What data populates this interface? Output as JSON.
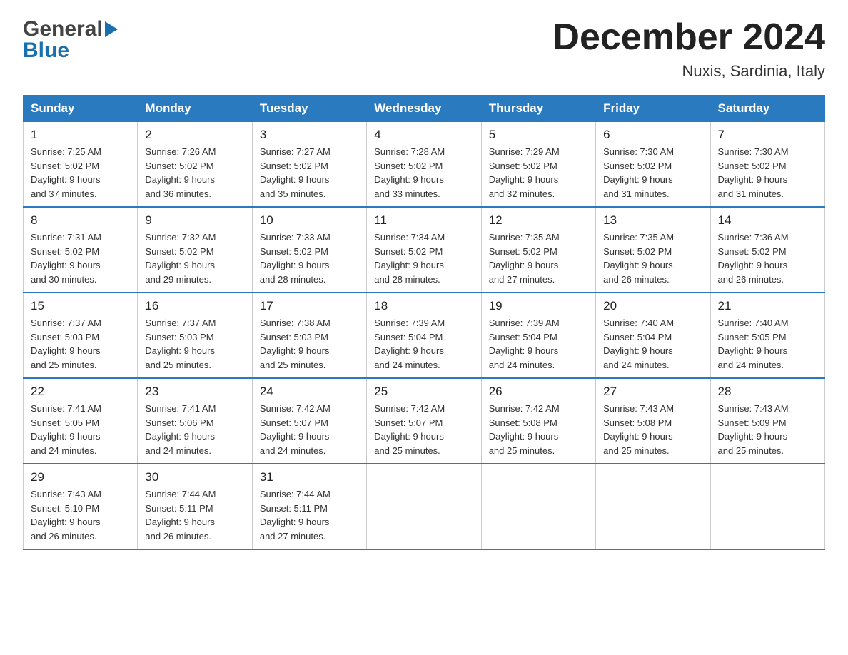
{
  "logo": {
    "line1": "General",
    "line2": "Blue"
  },
  "title": "December 2024",
  "subtitle": "Nuxis, Sardinia, Italy",
  "days_of_week": [
    "Sunday",
    "Monday",
    "Tuesday",
    "Wednesday",
    "Thursday",
    "Friday",
    "Saturday"
  ],
  "weeks": [
    [
      {
        "day": "1",
        "sunrise": "Sunrise: 7:25 AM",
        "sunset": "Sunset: 5:02 PM",
        "daylight": "Daylight: 9 hours",
        "daylight2": "and 37 minutes."
      },
      {
        "day": "2",
        "sunrise": "Sunrise: 7:26 AM",
        "sunset": "Sunset: 5:02 PM",
        "daylight": "Daylight: 9 hours",
        "daylight2": "and 36 minutes."
      },
      {
        "day": "3",
        "sunrise": "Sunrise: 7:27 AM",
        "sunset": "Sunset: 5:02 PM",
        "daylight": "Daylight: 9 hours",
        "daylight2": "and 35 minutes."
      },
      {
        "day": "4",
        "sunrise": "Sunrise: 7:28 AM",
        "sunset": "Sunset: 5:02 PM",
        "daylight": "Daylight: 9 hours",
        "daylight2": "and 33 minutes."
      },
      {
        "day": "5",
        "sunrise": "Sunrise: 7:29 AM",
        "sunset": "Sunset: 5:02 PM",
        "daylight": "Daylight: 9 hours",
        "daylight2": "and 32 minutes."
      },
      {
        "day": "6",
        "sunrise": "Sunrise: 7:30 AM",
        "sunset": "Sunset: 5:02 PM",
        "daylight": "Daylight: 9 hours",
        "daylight2": "and 31 minutes."
      },
      {
        "day": "7",
        "sunrise": "Sunrise: 7:30 AM",
        "sunset": "Sunset: 5:02 PM",
        "daylight": "Daylight: 9 hours",
        "daylight2": "and 31 minutes."
      }
    ],
    [
      {
        "day": "8",
        "sunrise": "Sunrise: 7:31 AM",
        "sunset": "Sunset: 5:02 PM",
        "daylight": "Daylight: 9 hours",
        "daylight2": "and 30 minutes."
      },
      {
        "day": "9",
        "sunrise": "Sunrise: 7:32 AM",
        "sunset": "Sunset: 5:02 PM",
        "daylight": "Daylight: 9 hours",
        "daylight2": "and 29 minutes."
      },
      {
        "day": "10",
        "sunrise": "Sunrise: 7:33 AM",
        "sunset": "Sunset: 5:02 PM",
        "daylight": "Daylight: 9 hours",
        "daylight2": "and 28 minutes."
      },
      {
        "day": "11",
        "sunrise": "Sunrise: 7:34 AM",
        "sunset": "Sunset: 5:02 PM",
        "daylight": "Daylight: 9 hours",
        "daylight2": "and 28 minutes."
      },
      {
        "day": "12",
        "sunrise": "Sunrise: 7:35 AM",
        "sunset": "Sunset: 5:02 PM",
        "daylight": "Daylight: 9 hours",
        "daylight2": "and 27 minutes."
      },
      {
        "day": "13",
        "sunrise": "Sunrise: 7:35 AM",
        "sunset": "Sunset: 5:02 PM",
        "daylight": "Daylight: 9 hours",
        "daylight2": "and 26 minutes."
      },
      {
        "day": "14",
        "sunrise": "Sunrise: 7:36 AM",
        "sunset": "Sunset: 5:02 PM",
        "daylight": "Daylight: 9 hours",
        "daylight2": "and 26 minutes."
      }
    ],
    [
      {
        "day": "15",
        "sunrise": "Sunrise: 7:37 AM",
        "sunset": "Sunset: 5:03 PM",
        "daylight": "Daylight: 9 hours",
        "daylight2": "and 25 minutes."
      },
      {
        "day": "16",
        "sunrise": "Sunrise: 7:37 AM",
        "sunset": "Sunset: 5:03 PM",
        "daylight": "Daylight: 9 hours",
        "daylight2": "and 25 minutes."
      },
      {
        "day": "17",
        "sunrise": "Sunrise: 7:38 AM",
        "sunset": "Sunset: 5:03 PM",
        "daylight": "Daylight: 9 hours",
        "daylight2": "and 25 minutes."
      },
      {
        "day": "18",
        "sunrise": "Sunrise: 7:39 AM",
        "sunset": "Sunset: 5:04 PM",
        "daylight": "Daylight: 9 hours",
        "daylight2": "and 24 minutes."
      },
      {
        "day": "19",
        "sunrise": "Sunrise: 7:39 AM",
        "sunset": "Sunset: 5:04 PM",
        "daylight": "Daylight: 9 hours",
        "daylight2": "and 24 minutes."
      },
      {
        "day": "20",
        "sunrise": "Sunrise: 7:40 AM",
        "sunset": "Sunset: 5:04 PM",
        "daylight": "Daylight: 9 hours",
        "daylight2": "and 24 minutes."
      },
      {
        "day": "21",
        "sunrise": "Sunrise: 7:40 AM",
        "sunset": "Sunset: 5:05 PM",
        "daylight": "Daylight: 9 hours",
        "daylight2": "and 24 minutes."
      }
    ],
    [
      {
        "day": "22",
        "sunrise": "Sunrise: 7:41 AM",
        "sunset": "Sunset: 5:05 PM",
        "daylight": "Daylight: 9 hours",
        "daylight2": "and 24 minutes."
      },
      {
        "day": "23",
        "sunrise": "Sunrise: 7:41 AM",
        "sunset": "Sunset: 5:06 PM",
        "daylight": "Daylight: 9 hours",
        "daylight2": "and 24 minutes."
      },
      {
        "day": "24",
        "sunrise": "Sunrise: 7:42 AM",
        "sunset": "Sunset: 5:07 PM",
        "daylight": "Daylight: 9 hours",
        "daylight2": "and 24 minutes."
      },
      {
        "day": "25",
        "sunrise": "Sunrise: 7:42 AM",
        "sunset": "Sunset: 5:07 PM",
        "daylight": "Daylight: 9 hours",
        "daylight2": "and 25 minutes."
      },
      {
        "day": "26",
        "sunrise": "Sunrise: 7:42 AM",
        "sunset": "Sunset: 5:08 PM",
        "daylight": "Daylight: 9 hours",
        "daylight2": "and 25 minutes."
      },
      {
        "day": "27",
        "sunrise": "Sunrise: 7:43 AM",
        "sunset": "Sunset: 5:08 PM",
        "daylight": "Daylight: 9 hours",
        "daylight2": "and 25 minutes."
      },
      {
        "day": "28",
        "sunrise": "Sunrise: 7:43 AM",
        "sunset": "Sunset: 5:09 PM",
        "daylight": "Daylight: 9 hours",
        "daylight2": "and 25 minutes."
      }
    ],
    [
      {
        "day": "29",
        "sunrise": "Sunrise: 7:43 AM",
        "sunset": "Sunset: 5:10 PM",
        "daylight": "Daylight: 9 hours",
        "daylight2": "and 26 minutes."
      },
      {
        "day": "30",
        "sunrise": "Sunrise: 7:44 AM",
        "sunset": "Sunset: 5:11 PM",
        "daylight": "Daylight: 9 hours",
        "daylight2": "and 26 minutes."
      },
      {
        "day": "31",
        "sunrise": "Sunrise: 7:44 AM",
        "sunset": "Sunset: 5:11 PM",
        "daylight": "Daylight: 9 hours",
        "daylight2": "and 27 minutes."
      },
      null,
      null,
      null,
      null
    ]
  ]
}
